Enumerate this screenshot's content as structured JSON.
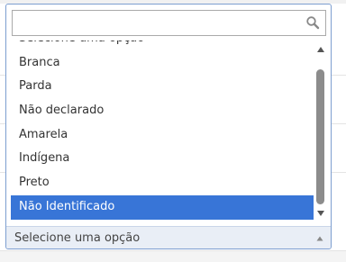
{
  "select": {
    "search": {
      "value": "",
      "placeholder": ""
    },
    "options": [
      "Selecione uma opção",
      "Branca",
      "Parda",
      "Não declarado",
      "Amarela",
      "Indígena",
      "Preto",
      "Não Identificado"
    ],
    "highlighted_index": 7,
    "selected_label": "Selecione uma opção"
  },
  "icons": {
    "search": "search-icon",
    "scroll_up": "scroll-up-arrow-icon",
    "scroll_down": "scroll-down-arrow-icon",
    "dropdown_arrow": "triangle-up-icon"
  },
  "colors": {
    "highlight": "#3875d7",
    "highlight_text": "#ffffff",
    "border": "#7d9ed0",
    "scroll_thumb": "#8c8c8c"
  }
}
